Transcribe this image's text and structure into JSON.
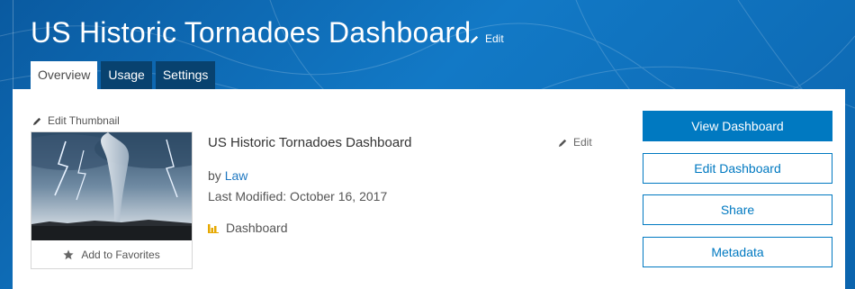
{
  "header": {
    "title": "US Historic Tornadoes Dashboard",
    "edit_label": "Edit"
  },
  "tabs": [
    {
      "label": "Overview",
      "active": true
    },
    {
      "label": "Usage",
      "active": false
    },
    {
      "label": "Settings",
      "active": false
    }
  ],
  "thumbnail": {
    "edit_label": "Edit Thumbnail",
    "favorites_label": "Add to Favorites"
  },
  "item": {
    "title": "US Historic Tornadoes Dashboard",
    "edit_label": "Edit",
    "by_prefix": "by",
    "owner": "Law",
    "last_modified": "Last Modified: October 16, 2017",
    "type": "Dashboard"
  },
  "actions": {
    "view": "View Dashboard",
    "edit": "Edit Dashboard",
    "share": "Share",
    "metadata": "Metadata"
  },
  "colors": {
    "header_bg": "#0b64ad",
    "tab_bg": "#08426f",
    "accent": "#0079c1",
    "link": "#1f78c1",
    "type_icon": "#e6a800"
  },
  "icons": [
    "pencil-icon",
    "star-icon",
    "bar-chart-icon"
  ]
}
